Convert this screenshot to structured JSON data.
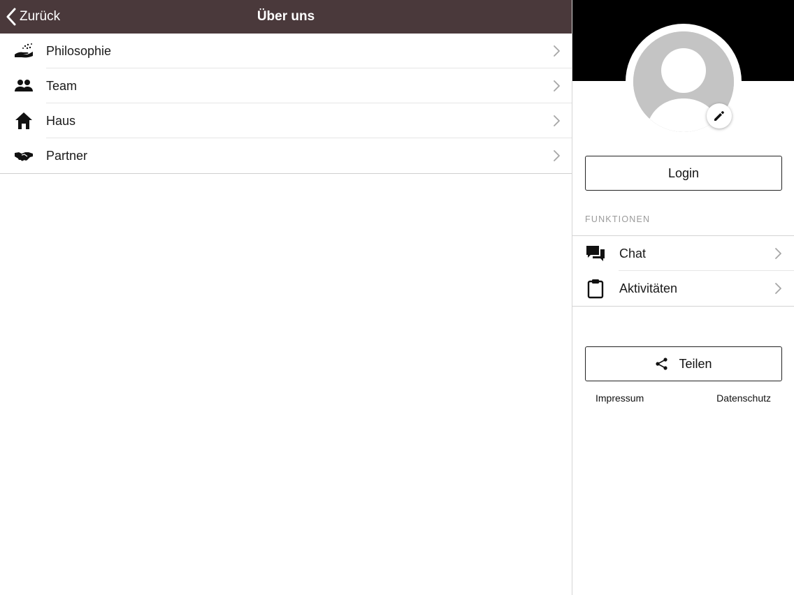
{
  "navbar": {
    "back_label": "Zurück",
    "title": "Über uns",
    "background": "#4a393b"
  },
  "menu": {
    "items": [
      {
        "label": "Philosophie",
        "icon": "hand-sparkle-icon"
      },
      {
        "label": "Team",
        "icon": "people-icon"
      },
      {
        "label": "Haus",
        "icon": "home-icon"
      },
      {
        "label": "Partner",
        "icon": "handshake-icon"
      }
    ]
  },
  "profile": {
    "avatar_icon": "avatar-placeholder-icon",
    "edit_icon": "pencil-icon",
    "login_label": "Login"
  },
  "functions": {
    "section_title": "FUNKTIONEN",
    "items": [
      {
        "label": "Chat",
        "icon": "chat-icon"
      },
      {
        "label": "Aktivitäten",
        "icon": "clipboard-icon"
      }
    ]
  },
  "share": {
    "label": "Teilen",
    "icon": "share-icon"
  },
  "footer": {
    "impressum": "Impressum",
    "datenschutz": "Datenschutz"
  }
}
